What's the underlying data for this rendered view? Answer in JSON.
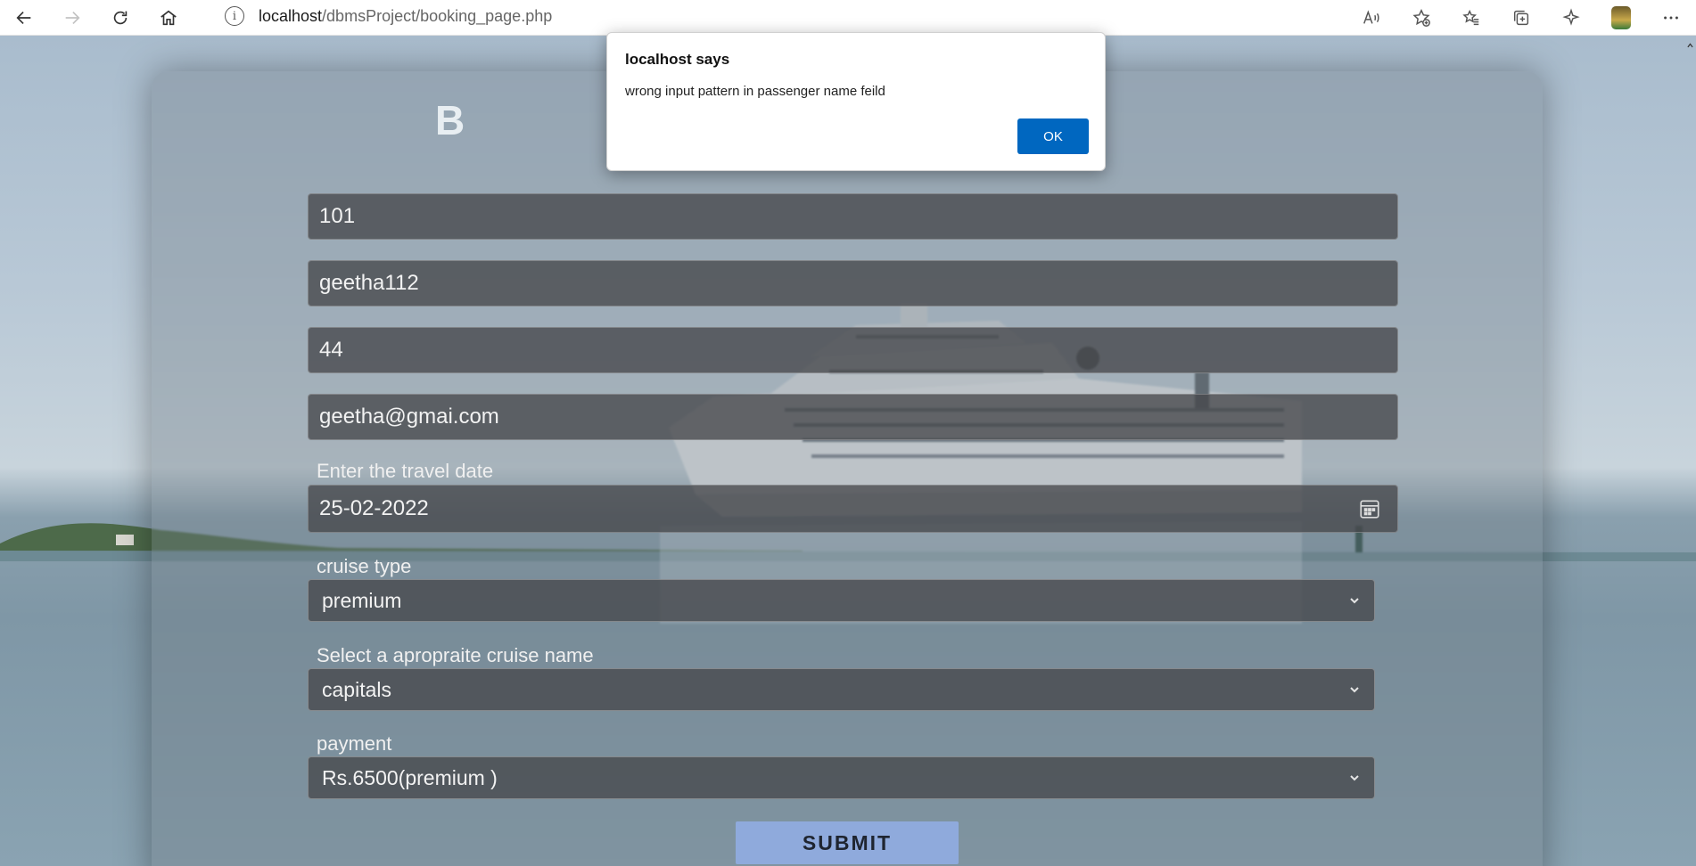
{
  "browser": {
    "url_host": "localhost",
    "url_path": "/dbmsProject/booking_page.php"
  },
  "form": {
    "title": "B",
    "id_value": "101",
    "name_value": "geetha112",
    "age_value": "44",
    "email_value": "geetha@gmai.com",
    "date_label": "Enter the travel date",
    "date_value": "25-02-2022",
    "cruise_type_label": "cruise type",
    "cruise_type_value": "premium",
    "cruise_name_label": "Select a apropraite cruise name",
    "cruise_name_value": "capitals",
    "payment_label": "payment",
    "payment_value": "Rs.6500(premium )",
    "submit_label": "SUBMIT"
  },
  "dialog": {
    "title": "localhost says",
    "message": "wrong input pattern in passenger name feild",
    "ok_label": "OK"
  },
  "colors": {
    "submit_bg": "#8faadc",
    "ok_bg": "#0067c0"
  }
}
